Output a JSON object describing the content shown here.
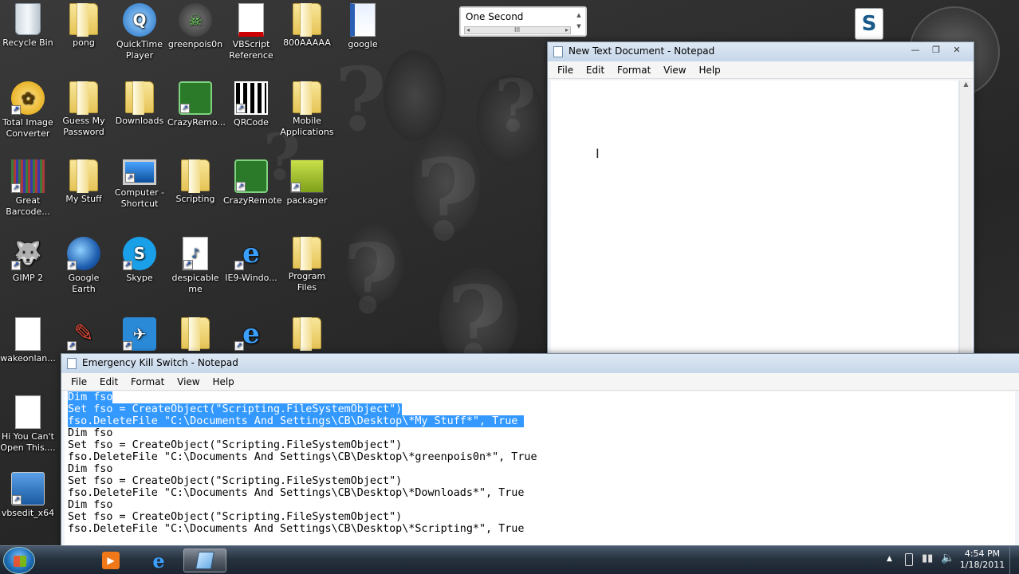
{
  "desktop_icons": [
    {
      "label": "Recycle Bin",
      "icon": "recycle-bin-icon"
    },
    {
      "label": "pong",
      "icon": "folder-icon"
    },
    {
      "label": "QuickTime Player",
      "icon": "quicktime-icon"
    },
    {
      "label": "greenpois0n",
      "icon": "greenpois0n-icon"
    },
    {
      "label": "VBScript Reference",
      "icon": "pdf-icon"
    },
    {
      "label": "800AAAAA",
      "icon": "folder-icon"
    },
    {
      "label": "google",
      "icon": "word-doc-icon"
    },
    {
      "label": "Total Image Converter",
      "icon": "image-converter-icon"
    },
    {
      "label": "Guess My Password",
      "icon": "folder-icon"
    },
    {
      "label": "Downloads",
      "icon": "downloads-folder-icon"
    },
    {
      "label": "CrazyRemo...",
      "icon": "crazyremote-icon"
    },
    {
      "label": "QRCode",
      "icon": "qrcode-icon"
    },
    {
      "label": "Mobile Applications",
      "icon": "folder-icon"
    },
    {
      "label": "Great Barcode...",
      "icon": "barcode-icon"
    },
    {
      "label": "My Stuff",
      "icon": "folder-icon"
    },
    {
      "label": "Computer - Shortcut",
      "icon": "computer-icon"
    },
    {
      "label": "Scripting",
      "icon": "folder-icon"
    },
    {
      "label": "CrazyRemote",
      "icon": "crazyremote-icon"
    },
    {
      "label": "packager",
      "icon": "packager-icon"
    },
    {
      "label": "GIMP 2",
      "icon": "gimp-icon"
    },
    {
      "label": "Google Earth",
      "icon": "google-earth-icon"
    },
    {
      "label": "Skype",
      "icon": "skype-icon"
    },
    {
      "label": "despicable me",
      "icon": "mp3-icon"
    },
    {
      "label": "IE9-Windo...",
      "icon": "ie-icon"
    },
    {
      "label": "Program Files",
      "icon": "folder-icon"
    },
    {
      "label": "wakeonlan...",
      "icon": "file-icon"
    },
    {
      "label": "",
      "icon": "pencil-icon"
    },
    {
      "label": "",
      "icon": "plane-icon"
    },
    {
      "label": "",
      "icon": "folder-icon"
    },
    {
      "label": "",
      "icon": "ie-icon"
    },
    {
      "label": "",
      "icon": "folder-icon"
    },
    {
      "label": "Hi You Can't Open This....",
      "icon": "file-icon"
    },
    {
      "label": "vbsedit_x64",
      "icon": "vbsedit-icon"
    }
  ],
  "gadget": {
    "text": "One Second",
    "scroll_mark": "III"
  },
  "notepad_new": {
    "title": "New Text Document - Notepad",
    "menu": [
      "File",
      "Edit",
      "Format",
      "View",
      "Help"
    ],
    "controls": [
      "—",
      "❐",
      "✕"
    ]
  },
  "notepad_kill": {
    "title": "Emergency Kill Switch - Notepad",
    "menu": [
      "File",
      "Edit",
      "Format",
      "View",
      "Help"
    ],
    "lines": [
      {
        "text": "Dim fso",
        "selected": true
      },
      {
        "text": "Set fso = CreateObject(\"Scripting.FileSystemObject\")",
        "selected": true
      },
      {
        "text": "fso.DeleteFile \"C:\\Documents And Settings\\CB\\Desktop\\*My Stuff*\", True ",
        "selected": true
      },
      {
        "text": "Dim fso",
        "selected": false
      },
      {
        "text": "Set fso = CreateObject(\"Scripting.FileSystemObject\")",
        "selected": false
      },
      {
        "text": "fso.DeleteFile \"C:\\Documents And Settings\\CB\\Desktop\\*greenpois0n*\", True",
        "selected": false
      },
      {
        "text": "Dim fso",
        "selected": false
      },
      {
        "text": "Set fso = CreateObject(\"Scripting.FileSystemObject\")",
        "selected": false
      },
      {
        "text": "fso.DeleteFile \"C:\\Documents And Settings\\CB\\Desktop\\*Downloads*\", True",
        "selected": false
      },
      {
        "text": "Dim fso",
        "selected": false
      },
      {
        "text": "Set fso = CreateObject(\"Scripting.FileSystemObject\")",
        "selected": false
      },
      {
        "text": "fso.DeleteFile \"C:\\Documents And Settings\\CB\\Desktop\\*Scripting*\", True",
        "selected": false
      }
    ]
  },
  "taskbar": {
    "time": "4:54 PM",
    "date": "1/18/2011",
    "tray_arrow": "▲",
    "buttons": [
      {
        "name": "media-player-button",
        "icon": "media-player-icon"
      },
      {
        "name": "internet-explorer-button",
        "icon": "ie-icon"
      },
      {
        "name": "notepad-button",
        "icon": "notepad-icon",
        "active": true
      }
    ]
  },
  "colors": {
    "selection": "#3399ff",
    "window_chrome": "#c6d7ea",
    "taskbar": "#26323f"
  }
}
